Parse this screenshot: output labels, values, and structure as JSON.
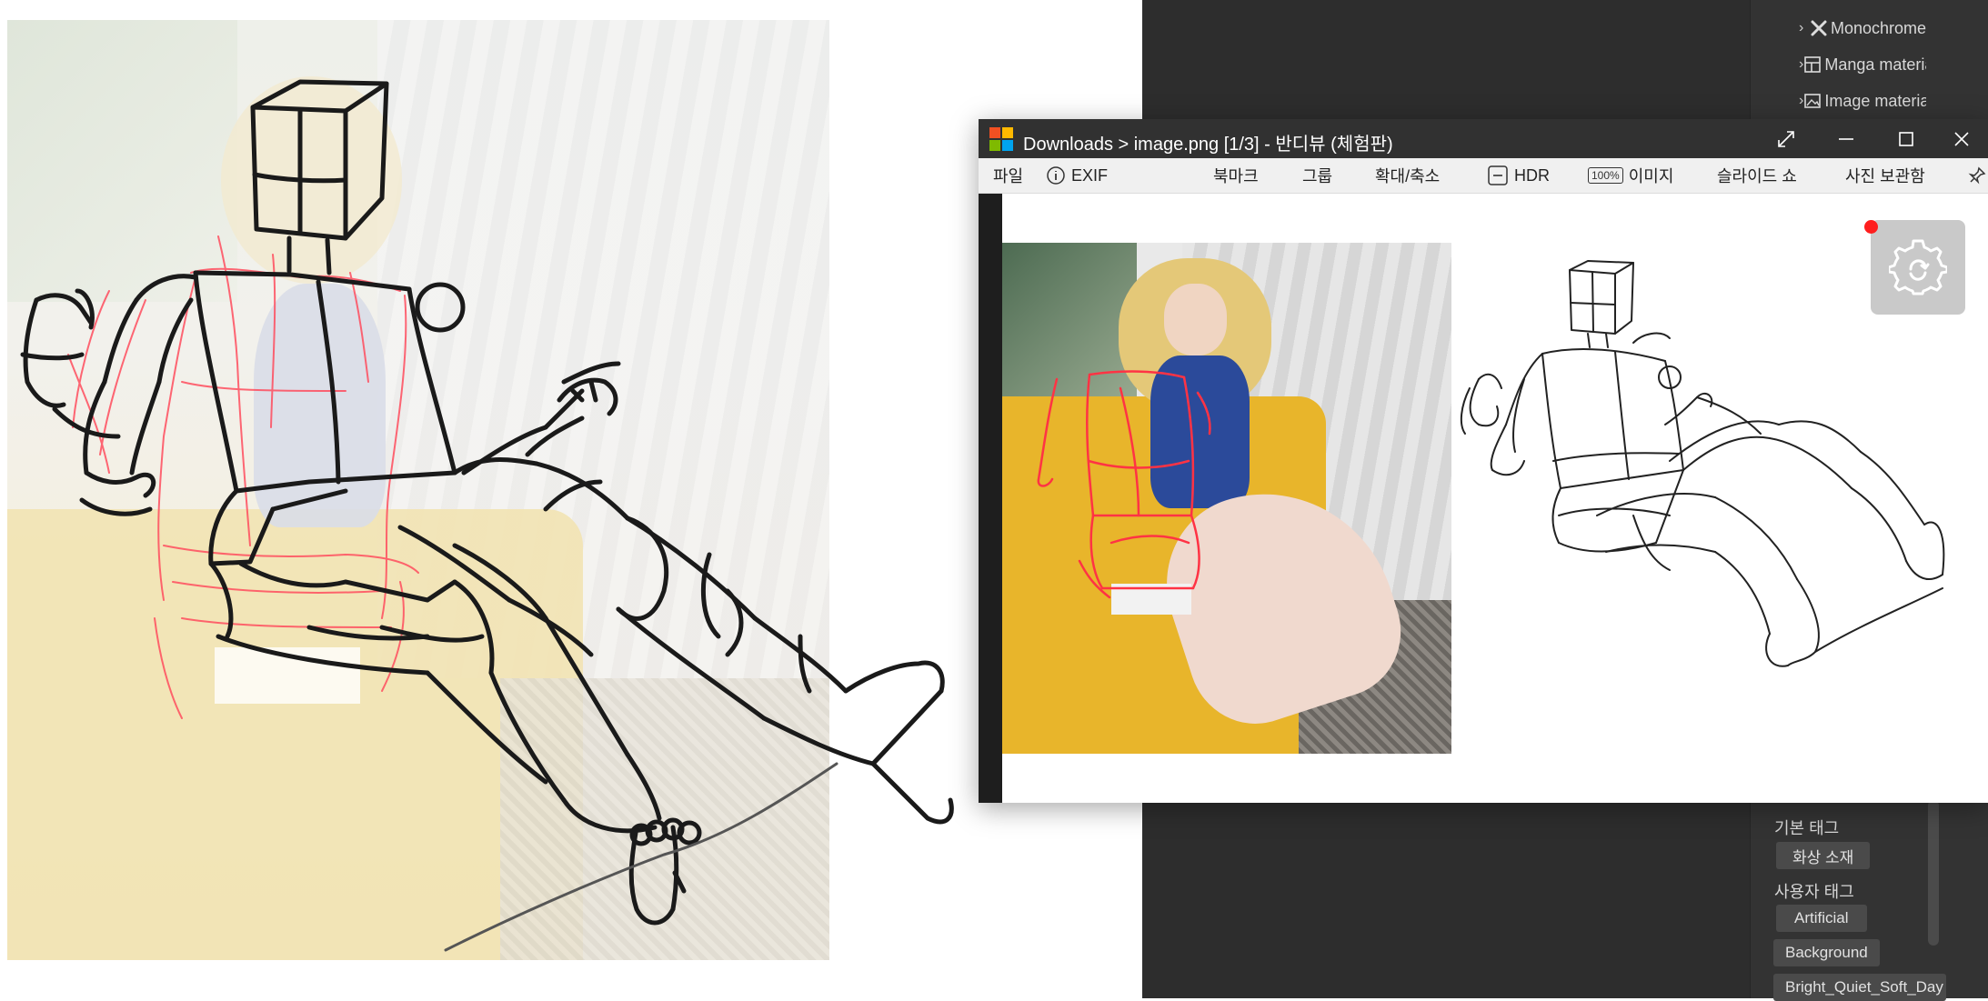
{
  "viewer": {
    "title": "Downloads > image.png [1/3] - 반디뷰 (체험판)",
    "menu": {
      "file": "파일",
      "exif": "EXIF",
      "bookmark": "북마크",
      "group": "그룹",
      "zoom": "확대/축소",
      "hdr": "HDR",
      "image_icon_label": "100%",
      "image": "이미지",
      "slideshow": "슬라이드 쇼",
      "photo_correction": "사진 보관함"
    }
  },
  "side_panel": {
    "tree_items": [
      {
        "label": "Monochrome",
        "icon": "sparkle-x-icon"
      },
      {
        "label": "Manga material",
        "icon": "layout-icon"
      },
      {
        "label": "Image material",
        "icon": "image-icon"
      }
    ],
    "basic_tags_label": "기본 태그",
    "basic_tags": [
      "화상 소재"
    ],
    "user_tags_label": "사용자 태그",
    "user_tags": [
      "Artificial",
      "Background",
      "Bright_Quiet_Soft_Day"
    ]
  },
  "colors": {
    "dark_bg": "#2d2d2d",
    "panel_bg": "#333333",
    "titlebar": "#313131",
    "menubar": "#f0f0f0",
    "red_sketch": "#ff4d5e",
    "black_sketch": "#1a1a1a",
    "notification_dot": "#ff1e1e"
  }
}
